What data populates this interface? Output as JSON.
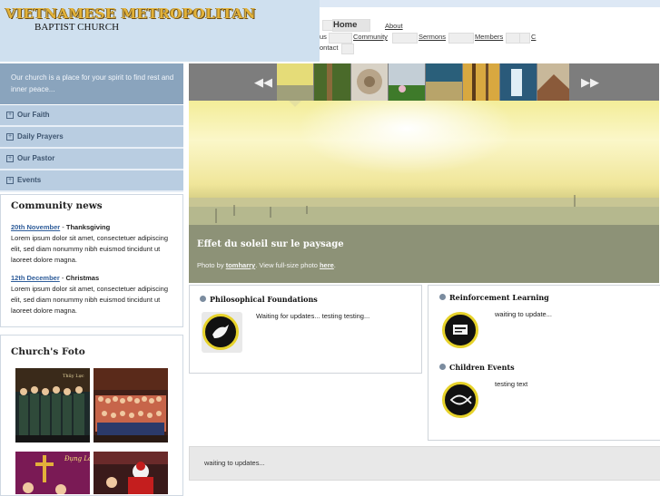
{
  "header": {
    "logo_line1": "VIETNAMESE METROPOLITAN",
    "logo_line2": "BAPTIST CHURCH",
    "nav": {
      "home": "Home",
      "about_a": "About",
      "about_b": "us",
      "community": "Community",
      "sermons": "Sermons",
      "members": "Members",
      "contact_a": "C",
      "contact_b": "ontact"
    }
  },
  "sidebar": {
    "intro": "Our church is a place for your spirit to find rest and inner peace...",
    "menu": [
      "Our Faith",
      "Daily Prayers",
      "Our Pastor",
      "Events"
    ],
    "news": {
      "title": "Community news",
      "items": [
        {
          "date": "20th November",
          "sep": " - ",
          "headline": "Thanksgiving",
          "body": "Lorem ipsum dolor sit amet, consectetuer adipiscing elit, sed diam nonummy nibh euismod tincidunt ut laoreet dolore magna."
        },
        {
          "date": "12th December",
          "sep": " - ",
          "headline": "Christmas",
          "body": "Lorem ipsum dolor sit amet, consectetuer adipiscing elit, sed diam nonummy nibh euismod tincidunt ut laoreet dolore magna."
        }
      ]
    },
    "foto": {
      "title": "Church's Foto",
      "photo3_caption": "Đụng Lò",
      "photo1_caption": "Thủy Lực"
    }
  },
  "slideshow": {
    "caption_title": "Effet du soleil sur le paysage",
    "credit_prefix": "Photo by ",
    "credit_author": "tomharry",
    "credit_mid": ". View full-size photo ",
    "credit_link": "here",
    "credit_end": "."
  },
  "boxes": {
    "philosophical": {
      "title": "Philosophical Foundations",
      "text": "Waiting for updates... testing testing..."
    },
    "reinforcement": {
      "title": "Reinforcement Learning",
      "text": "waiting to update..."
    },
    "children": {
      "title": "Children Events",
      "text": "testing text"
    }
  },
  "bottom": {
    "text": "waiting to updates..."
  },
  "colors": {
    "gold": "#e2b23a",
    "sidebar": "#b9cde1",
    "link": "#2f5d9a"
  }
}
